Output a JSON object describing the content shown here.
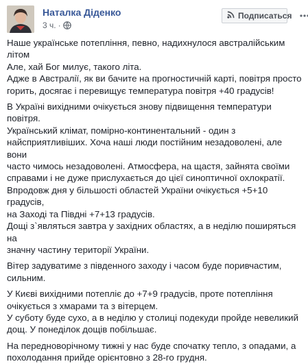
{
  "post": {
    "author": "Наталка Діденко",
    "time": "3 ч.",
    "follow_label": "Подписаться",
    "paragraphs": [
      "Наше українське потепління, певно, надихнулося австралійським літом\nАле, хай Бог милує, такого літа.\nАдже в Австралії, як ви бачите на прогностичній карті, повітря просто\nгорить, досягає і перевищує температура повітря +40 градусів!",
      "В Україні вихідними очікується знову підвищення температури повітря.\nУкраїнський клімат, помірно-континентальний - один з\nнайсприятливіших. Хоча наші люди постійним незадоволені, але вони\nчасто чимось незадоволені. Атмосфера, на щастя, зайнята своїми\nсправами і не дуже прислухається до цієї синоптичної охлократії.\nВпродовж дня у більшості областей України очікується +5+10 градусів,\nна Заході та Півдні +7+13 градусів.\nДощі з`являться завтра у західних областях, а в неділю поширяться на\nзначну частину території України.",
      "Вітер задуватиме з південного заходу і часом буде поривчастим,\nсильним.",
      "У Києві вихідними потепліє до +7+9 градусів, проте потепління\nочікується з хмарами та з вітерцем.\nУ суботу буде сухо, а в неділю у столиці подекуди пройде невеликий\nдощ. У понеділок дощів побільшає.",
      "На передноворічному тижні у нас буде спочатку тепло, з опадами, а\nпохолодання прийде орієнтовно з 28-го грудня."
    ]
  },
  "icons": {
    "privacy": "globe-icon",
    "follow": "rss-icon",
    "more": "more-dots-icon"
  },
  "colors": {
    "author": "#385898",
    "text": "#1d2129",
    "meta": "#606770"
  }
}
